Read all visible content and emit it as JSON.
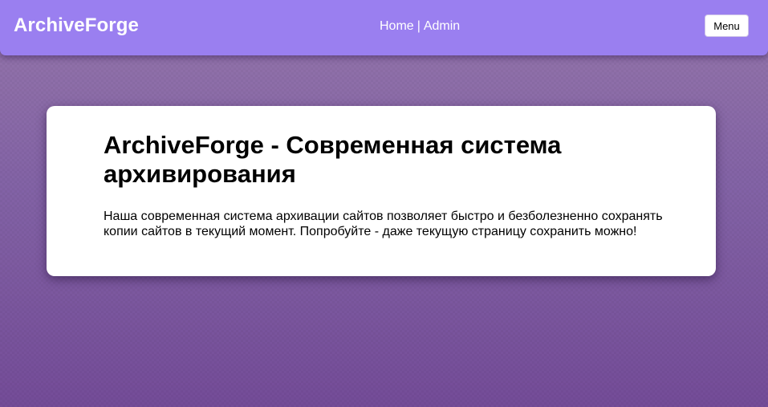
{
  "header": {
    "brand": "ArchiveForge",
    "nav": {
      "home": "Home",
      "separator": "|",
      "admin": "Admin"
    },
    "menu_label": "Menu"
  },
  "main": {
    "title": "ArchiveForge - Современная система архивирования",
    "description": "Наша современная система архивации сайтов позволяет быстро и безболезненно сохранять копии сайтов в текущий момент. Попробуйте - даже текущую страницу сохранить можно!"
  },
  "colors": {
    "header_bg": "#9a7ff0",
    "page_bg": "#7e5aa0",
    "card_bg": "#ffffff"
  }
}
